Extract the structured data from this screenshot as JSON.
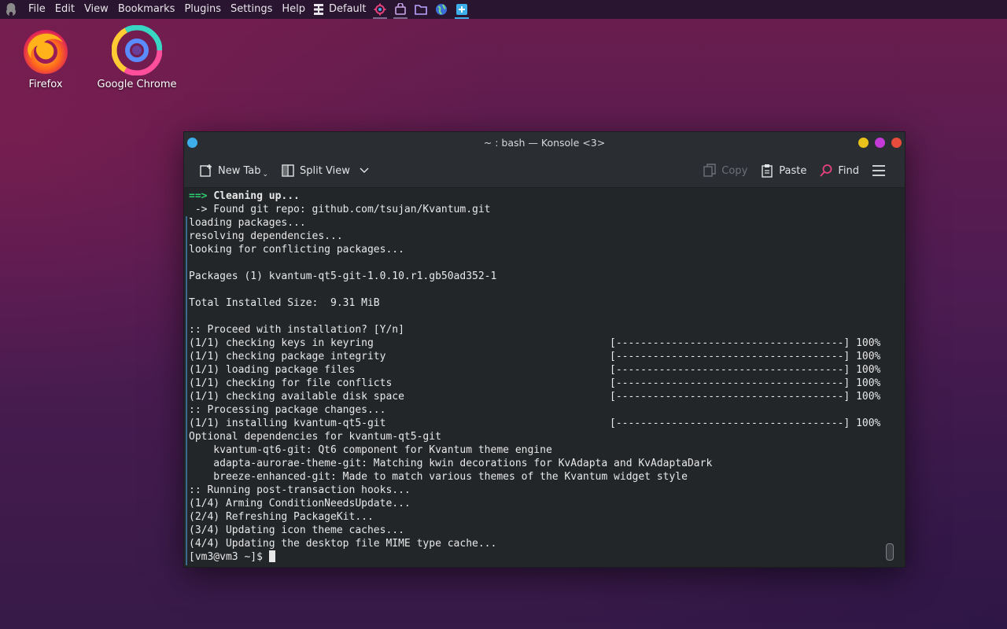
{
  "panel": {
    "menu": [
      "File",
      "Edit",
      "View",
      "Bookmarks",
      "Plugins",
      "Settings",
      "Help"
    ],
    "activity_label": "Default"
  },
  "desktop": {
    "icons": [
      {
        "label": "Firefox",
        "icon": "firefox-icon"
      },
      {
        "label": "Google Chrome",
        "icon": "chrome-icon"
      }
    ]
  },
  "window": {
    "title": "~ : bash — Konsole <3>",
    "buttons": {
      "minimize": "#e8c11a",
      "maximize": "#c33ad6",
      "close": "#e74c3c",
      "app": "#3daee9"
    },
    "toolbar": {
      "new_tab": "New Tab",
      "split_view": "Split View",
      "copy": "Copy",
      "paste": "Paste",
      "find": "Find"
    }
  },
  "terminal": {
    "lines": [
      {
        "prefix": "==> ",
        "text": "Cleaning up...",
        "style": "heading"
      },
      {
        "text": " -> Found git repo: github.com/tsujan/Kvantum.git"
      },
      {
        "text": "loading packages..."
      },
      {
        "text": "resolving dependencies..."
      },
      {
        "text": "looking for conflicting packages..."
      },
      {
        "text": ""
      },
      {
        "text": "Packages (1) kvantum-qt5-git-1.0.10.r1.gb50ad352-1"
      },
      {
        "text": ""
      },
      {
        "text": "Total Installed Size:  9.31 MiB"
      },
      {
        "text": ""
      },
      {
        "text": ":: Proceed with installation? [Y/n]"
      },
      {
        "text": "(1/1) checking keys in keyring",
        "bar": "[-------------------------------------] 100%"
      },
      {
        "text": "(1/1) checking package integrity",
        "bar": "[-------------------------------------] 100%"
      },
      {
        "text": "(1/1) loading package files",
        "bar": "[-------------------------------------] 100%"
      },
      {
        "text": "(1/1) checking for file conflicts",
        "bar": "[-------------------------------------] 100%"
      },
      {
        "text": "(1/1) checking available disk space",
        "bar": "[-------------------------------------] 100%"
      },
      {
        "text": ":: Processing package changes..."
      },
      {
        "text": "(1/1) installing kvantum-qt5-git",
        "bar": "[-------------------------------------] 100%"
      },
      {
        "text": "Optional dependencies for kvantum-qt5-git"
      },
      {
        "text": "    kvantum-qt6-git: Qt6 component for Kvantum theme engine"
      },
      {
        "text": "    adapta-aurorae-theme-git: Matching kwin decorations for KvAdapta and KvAdaptaDark"
      },
      {
        "text": "    breeze-enhanced-git: Made to match various themes of the Kvantum widget style"
      },
      {
        "text": ":: Running post-transaction hooks..."
      },
      {
        "text": "(1/4) Arming ConditionNeedsUpdate..."
      },
      {
        "text": "(2/4) Refreshing PackageKit..."
      },
      {
        "text": "(3/4) Updating icon theme caches..."
      },
      {
        "text": "(4/4) Updating the desktop file MIME type cache..."
      }
    ],
    "prompt": "[vm3@vm3 ~]$ "
  }
}
